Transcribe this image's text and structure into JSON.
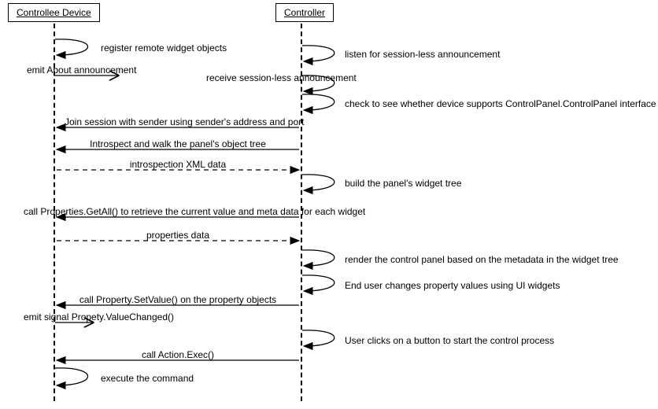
{
  "actors": {
    "controllee": "Controllee Device",
    "controller": "Controller"
  },
  "labels": {
    "register_widgets": "register remote widget objects",
    "emit_about": "emit About announcement",
    "listen_announce": "listen for session-less announcement",
    "receive_announce": "receive session-less announcement",
    "check_interface": "check to see whether device supports ControlPanel.ControlPanel interface",
    "join_session": "Join session with sender using sender's address and port",
    "introspect_walk": "Introspect and walk the panel's object tree",
    "introspection_xml": "introspection XML data",
    "build_tree": "build the panel's widget tree",
    "getall": "call Properties.GetAll() to retrieve the current value and meta data for each widget",
    "properties_data": "properties data",
    "render_panel": "render the control panel based on the metadata in the widget tree",
    "user_changes": "End user changes property values using UI widgets",
    "setvalue": "call Property.SetValue() on the property objects",
    "emit_valuechanged": "emit signal Propety.ValueChanged()",
    "user_clicks": "User clicks on a button to start the control process",
    "action_exec": "call Action.Exec()",
    "execute_cmd": "execute the command"
  }
}
